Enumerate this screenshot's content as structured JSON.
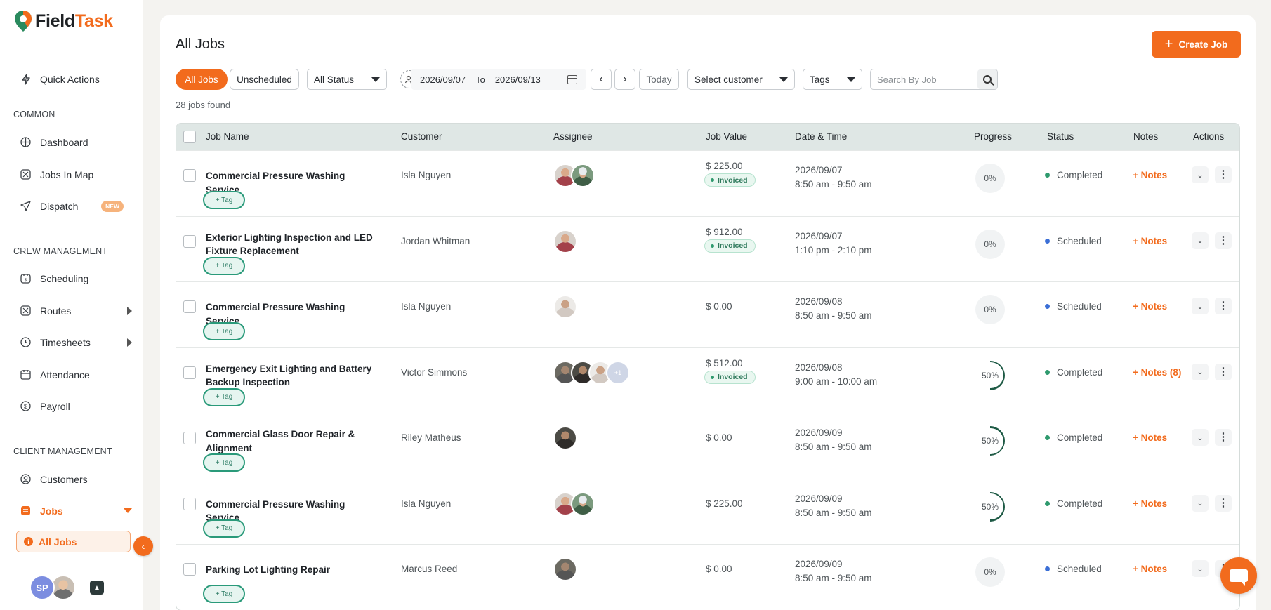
{
  "app": {
    "logo_part1": "Field",
    "logo_part2": "Task"
  },
  "colors": {
    "brand": "#f26b1d",
    "completed": "#2f9a6e",
    "scheduled": "#3b6fd6",
    "progress": "#1e5a45"
  },
  "sidebar": {
    "quick_actions": "Quick Actions",
    "sections": {
      "common": "COMMON",
      "crew": "CREW MANAGEMENT",
      "client": "CLIENT MANAGEMENT"
    },
    "items": {
      "dashboard": "Dashboard",
      "jobs_in_map": "Jobs In Map",
      "dispatch": "Dispatch",
      "dispatch_badge": "NEW",
      "scheduling": "Scheduling",
      "routes": "Routes",
      "timesheets": "Timesheets",
      "attendance": "Attendance",
      "payroll": "Payroll",
      "customers": "Customers",
      "jobs": "Jobs",
      "all_jobs": "All Jobs"
    },
    "user_initials": "SP"
  },
  "main": {
    "title": "All Jobs",
    "create_button": "Create Job",
    "filters": {
      "all_jobs": "All Jobs",
      "unscheduled": "Unscheduled",
      "status": "All Status",
      "date_from": "2026/09/07",
      "date_to_label": "To",
      "date_to": "2026/09/13",
      "today": "Today",
      "customer": "Select customer",
      "tags": "Tags",
      "search_placeholder": "Search By Job"
    },
    "count": "28 jobs found"
  },
  "table": {
    "headers": {
      "job_name": "Job Name",
      "customer": "Customer",
      "assignee": "Assignee",
      "job_value": "Job Value",
      "date_time": "Date & Time",
      "progress": "Progress",
      "status": "Status",
      "notes": "Notes",
      "actions": "Actions"
    },
    "tag_label": "+ Tag",
    "invoiced_label": "Invoiced",
    "rows": [
      {
        "name": "Commercial Pressure Washing Service",
        "customer": "Isla Nguyen",
        "value": "$ 225.00",
        "invoiced": true,
        "date": "2026/09/07",
        "time": "8:50 am - 9:50 am",
        "progress": "0%",
        "progress_value": 0,
        "status": "Completed",
        "notes": "+ Notes"
      },
      {
        "name": "Exterior Lighting Inspection and LED Fixture Replacement",
        "customer": "Jordan Whitman",
        "value": "$ 912.00",
        "invoiced": true,
        "date": "2026/09/07",
        "time": "1:10 pm - 2:10 pm",
        "progress": "0%",
        "progress_value": 0,
        "status": "Scheduled",
        "notes": "+ Notes"
      },
      {
        "name": "Commercial Pressure Washing Service",
        "customer": "Isla Nguyen",
        "value": "$ 0.00",
        "invoiced": false,
        "date": "2026/09/08",
        "time": "8:50 am - 9:50 am",
        "progress": "0%",
        "progress_value": 0,
        "status": "Scheduled",
        "notes": "+ Notes"
      },
      {
        "name": "Emergency Exit Lighting and Battery Backup Inspection",
        "customer": "Victor Simmons",
        "value": "$ 512.00",
        "invoiced": true,
        "date": "2026/09/08",
        "time": "9:00 am - 10:00 am",
        "progress": "50%",
        "progress_value": 50,
        "status": "Completed",
        "notes": "+ Notes (8)",
        "more_assignees": "+1"
      },
      {
        "name": "Commercial Glass Door Repair & Alignment",
        "customer": "Riley Matheus",
        "value": "$ 0.00",
        "invoiced": false,
        "date": "2026/09/09",
        "time": "8:50 am - 9:50 am",
        "progress": "50%",
        "progress_value": 50,
        "status": "Completed",
        "notes": "+ Notes"
      },
      {
        "name": "Commercial Pressure Washing Service",
        "customer": "Isla Nguyen",
        "value": "$ 225.00",
        "invoiced": false,
        "date": "2026/09/09",
        "time": "8:50 am - 9:50 am",
        "progress": "50%",
        "progress_value": 50,
        "status": "Completed",
        "notes": "+ Notes"
      },
      {
        "name": "Parking Lot Lighting Repair",
        "customer": "Marcus Reed",
        "value": "$ 0.00",
        "invoiced": false,
        "date": "2026/09/09",
        "time": "8:50 am - 9:50 am",
        "progress": "0%",
        "progress_value": 0,
        "status": "Scheduled",
        "notes": "+ Notes"
      }
    ]
  }
}
